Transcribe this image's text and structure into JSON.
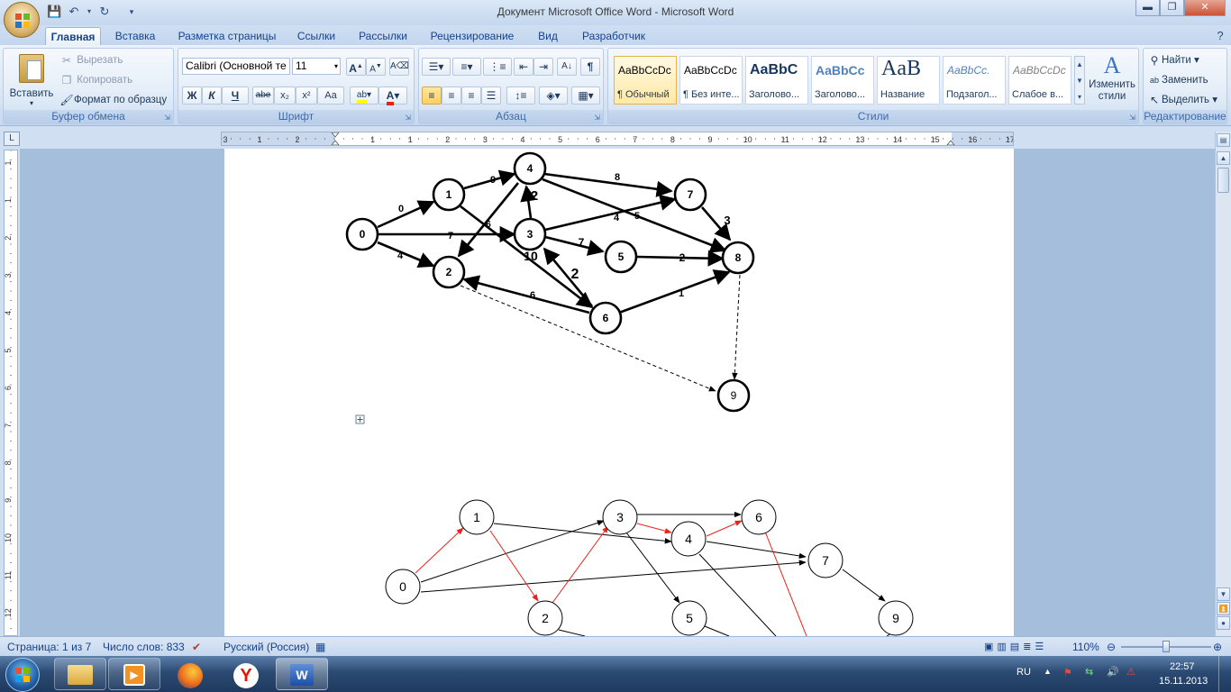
{
  "window": {
    "title": "Документ Microsoft Office Word - Microsoft Word",
    "controls": {
      "minimize": "▬",
      "maximize": "❐",
      "close": "✕"
    }
  },
  "tabs": [
    {
      "label": "Главная"
    },
    {
      "label": "Вставка"
    },
    {
      "label": "Разметка страницы"
    },
    {
      "label": "Ссылки"
    },
    {
      "label": "Рассылки"
    },
    {
      "label": "Рецензирование"
    },
    {
      "label": "Вид"
    },
    {
      "label": "Разработчик"
    }
  ],
  "ribbon": {
    "clipboard": {
      "group_label": "Буфер обмена",
      "paste": "Вставить",
      "cut": "Вырезать",
      "copy": "Копировать",
      "format_painter": "Формат по образцу"
    },
    "font": {
      "group_label": "Шрифт",
      "font_name": "Calibri (Основной те",
      "font_size": "11",
      "bold": "Ж",
      "italic": "К",
      "underline": "Ч",
      "strikethrough": "abe",
      "subscript": "x₂",
      "superscript": "x²",
      "change_case": "Aa"
    },
    "paragraph": {
      "group_label": "Абзац"
    },
    "styles": {
      "group_label": "Стили",
      "items": [
        {
          "sample": "AaBbCcDc",
          "name": "¶ Обычный"
        },
        {
          "sample": "AaBbCcDc",
          "name": "¶ Без инте..."
        },
        {
          "sample": "AaBbC",
          "name": "Заголово..."
        },
        {
          "sample": "AaBbCc",
          "name": "Заголово..."
        },
        {
          "sample": "AaB",
          "name": "Название"
        },
        {
          "sample": "AaBbCc.",
          "name": "Подзагол..."
        },
        {
          "sample": "AaBbCcDc",
          "name": "Слабое в..."
        }
      ],
      "change_styles": "Изменить стили"
    },
    "editing": {
      "group_label": "Редактирование",
      "find": "Найти",
      "replace": "Заменить",
      "select": "Выделить"
    }
  },
  "ruler": {
    "h_numbers": [
      "3",
      "1",
      "2",
      "1",
      "1",
      "2",
      "3",
      "4",
      "5",
      "6",
      "7",
      "8",
      "9",
      "10",
      "11",
      "12",
      "13",
      "14",
      "15",
      "16",
      "17"
    ],
    "v_numbers": [
      "1",
      "1",
      "2",
      "3",
      "4",
      "5",
      "6",
      "7",
      "8",
      "9",
      "10",
      "11",
      "12"
    ]
  },
  "document": {
    "graph1": {
      "nodes": [
        {
          "label": "0"
        },
        {
          "label": "1"
        },
        {
          "label": "2"
        },
        {
          "label": "3"
        },
        {
          "label": "4"
        },
        {
          "label": "5"
        },
        {
          "label": "6"
        },
        {
          "label": "7"
        },
        {
          "label": "8"
        },
        {
          "label": "9"
        }
      ],
      "edge_labels": [
        "0",
        "7",
        "4",
        "9",
        "6",
        "8",
        "2",
        "4",
        "5",
        "3",
        "7",
        "10",
        "2",
        "2",
        "6",
        "1"
      ]
    },
    "graph2": {
      "nodes": [
        {
          "label": "0"
        },
        {
          "label": "1"
        },
        {
          "label": "2"
        },
        {
          "label": "3"
        },
        {
          "label": "4"
        },
        {
          "label": "5"
        },
        {
          "label": "6"
        },
        {
          "label": "7"
        },
        {
          "label": "9"
        }
      ]
    },
    "anchor_icon": "table-move-handle-icon"
  },
  "status": {
    "page": "Страница: 1 из 7",
    "words": "Число слов: 833",
    "language": "Русский (Россия)",
    "zoom": "110%"
  },
  "taskbar": {
    "lang": "RU",
    "time": "22:57",
    "date": "15.11.2013"
  },
  "colors": {
    "accent": "#15428b",
    "red_edge": "#e8231b",
    "document_bg": "#a5bedc"
  }
}
